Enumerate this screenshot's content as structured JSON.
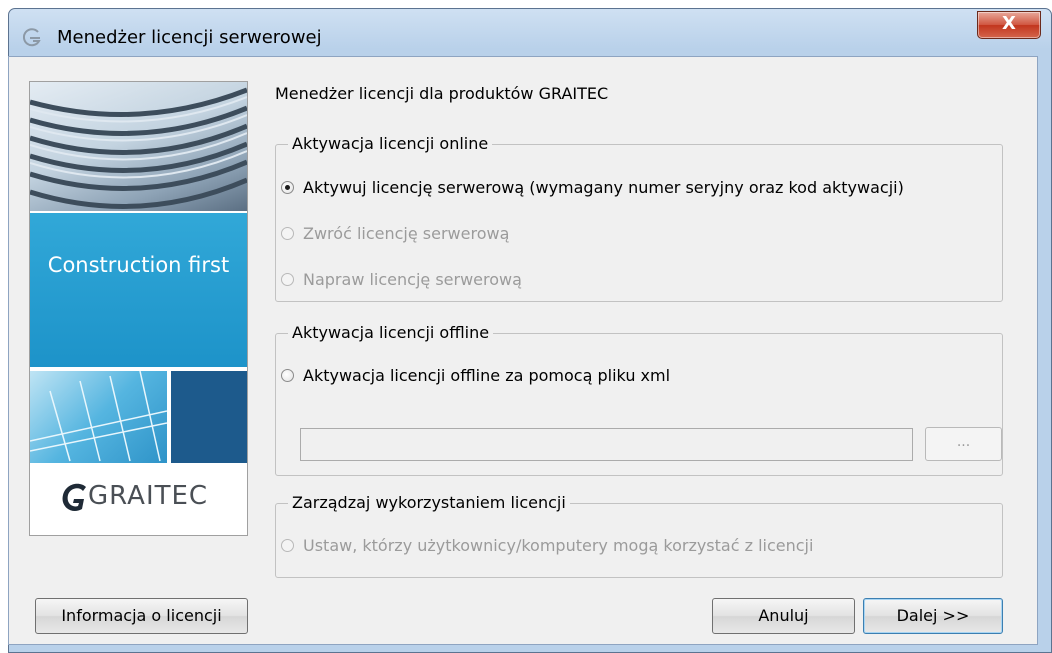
{
  "window": {
    "title": "Menedżer licencji serwerowej",
    "close_glyph": "X"
  },
  "banner": {
    "tagline": "Construction first",
    "logo_text": "GRAITEC"
  },
  "heading": "Menedżer licencji dla produktów GRAITEC",
  "online_group": {
    "label": "Aktywacja licencji online",
    "options": [
      {
        "label": "Aktywuj licencję serwerową (wymagany numer seryjny oraz kod aktywacji)",
        "checked": true,
        "enabled": true
      },
      {
        "label": "Zwróć licencję serwerową",
        "checked": false,
        "enabled": false
      },
      {
        "label": "Napraw licencję serwerową",
        "checked": false,
        "enabled": false
      }
    ]
  },
  "offline_group": {
    "label": "Aktywacja licencji offline",
    "option": {
      "label": "Aktywacja licencji offline za pomocą pliku xml",
      "checked": false,
      "enabled": true
    },
    "path_value": "",
    "browse_label": "..."
  },
  "manage_group": {
    "label": "Zarządzaj wykorzystaniem licencji",
    "option": {
      "label": "Ustaw, którzy użytkownicy/komputery mogą korzystać z licencji",
      "checked": false,
      "enabled": false
    }
  },
  "buttons": {
    "info": "Informacja o licencji",
    "cancel": "Anuluj",
    "next": "Dalej >>"
  },
  "colors": {
    "banner_blue": "#1d93c9",
    "banner_dark": "#1d5a8c",
    "close_red": "#c2361e"
  }
}
